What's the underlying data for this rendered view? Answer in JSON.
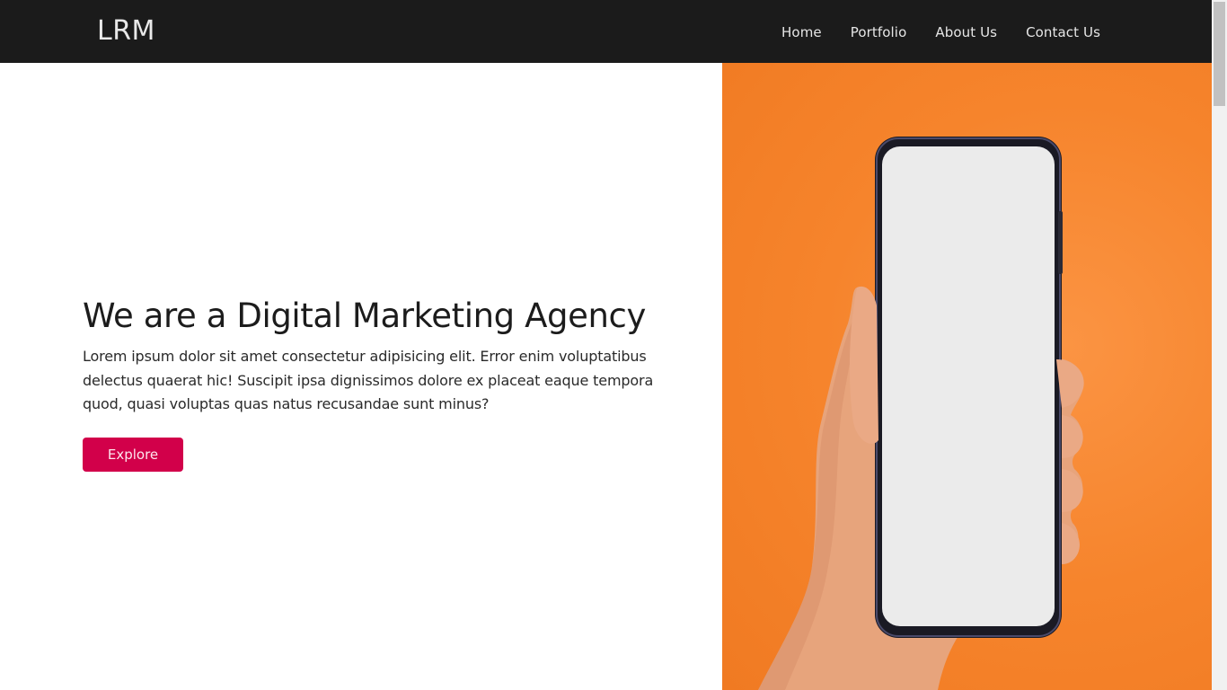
{
  "navbar": {
    "brand": "LRM",
    "links": [
      "Home",
      "Portfolio",
      "About Us",
      "Contact Us"
    ]
  },
  "hero": {
    "title": "We are a Digital Marketing Agency",
    "text": "Lorem ipsum dolor sit amet consectetur adipisicing elit. Error enim voluptatibus delectus quaerat hic! Suscipit ipsa dignissimos dolore ex placeat eaque tempora quod, quasi voluptas quas natus recusandae sunt minus?",
    "button_label": "Explore"
  },
  "colors": {
    "navbar_bg": "#1b1b1b",
    "accent": "#d2004a",
    "hero_image_bg": "#f6842c"
  },
  "image": {
    "subject": "hand-holding-phone"
  }
}
